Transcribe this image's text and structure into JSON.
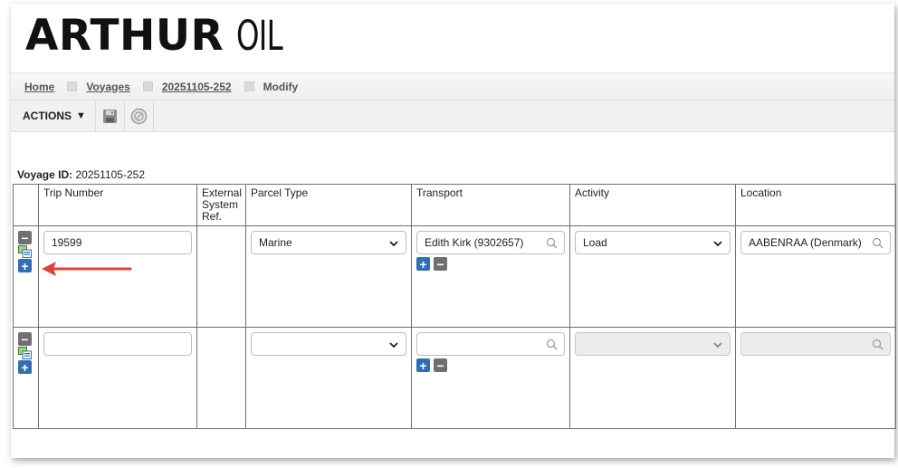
{
  "logo": {
    "main": "ARTHUR",
    "sub": "OIL"
  },
  "breadcrumb": {
    "home": "Home",
    "voyages": "Voyages",
    "voyage_id": "20251105-252",
    "current": "Modify"
  },
  "toolbar": {
    "actions_label": "ACTIONS",
    "save_icon": "save-icon",
    "cancel_icon": "cancel-icon"
  },
  "voyage": {
    "label": "Voyage ID:",
    "value": "20251105-252"
  },
  "table": {
    "headers": {
      "trip_number": "Trip Number",
      "external_ref": "External System Ref.",
      "parcel_type": "Parcel Type",
      "transport": "Transport",
      "activity": "Activity",
      "location": "Location"
    },
    "rows": [
      {
        "trip_number": "19599",
        "external_ref": "",
        "parcel_type": "Marine",
        "transport": "Edith Kirk (9302657)",
        "activity": "Load",
        "location": "AABENRAA (Denmark)"
      },
      {
        "trip_number": "",
        "external_ref": "",
        "parcel_type": "",
        "transport": "",
        "activity": "",
        "location": ""
      }
    ]
  },
  "colors": {
    "plus_button": "#2f6db5",
    "minus_button": "#6f6f6f",
    "annotation_arrow": "#e0403a"
  }
}
